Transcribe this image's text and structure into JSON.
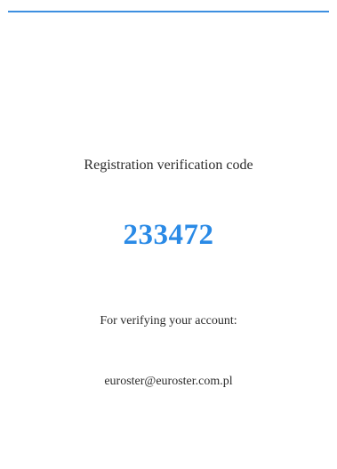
{
  "email_card": {
    "heading": "Registration verification code",
    "code": "233472",
    "verify_label": "For verifying your account:",
    "email": "euroster@euroster.com.pl"
  },
  "colors": {
    "accent": "#2a8ae6",
    "top_line": "#3d8fe0",
    "text": "#2b2b2b",
    "background": "#ffffff"
  }
}
